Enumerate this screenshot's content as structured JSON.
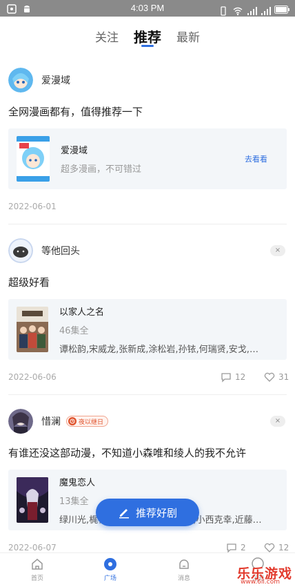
{
  "status_bar": {
    "time": "4:03 PM"
  },
  "tabs": [
    {
      "label": "关注",
      "active": false
    },
    {
      "label": "推荐",
      "active": true
    },
    {
      "label": "最新",
      "active": false
    }
  ],
  "posts": [
    {
      "username": "爱漫域",
      "text": "全网漫画都有，值得推荐一下",
      "card": {
        "title": "爱漫域",
        "subtitle": "超多漫画，不可错过",
        "action": "去看看"
      },
      "date": "2022-06-01"
    },
    {
      "username": "等他回头",
      "close": "×",
      "text": "超级好看",
      "card": {
        "title": "以家人之名",
        "episodes": "46集全",
        "cast": "谭松韵,宋威龙,张新成,涂松岩,孙铱,何瑞贤,安戈,苑..."
      },
      "date": "2022-06-06",
      "comments": "12",
      "likes": "31"
    },
    {
      "username": "惜澜",
      "badge": "夜以继日",
      "close": "×",
      "text": "有谁还没这部动漫，不知道小森唯和绫人的我不允许",
      "card": {
        "title": "魔鬼恋人",
        "episodes": "13集全",
        "cast": "绿川光,梶裕贵,平川大辅,鸟海浩辅,小西克幸,近藤隆..."
      },
      "date": "2022-06-07",
      "comments": "2",
      "likes": "12"
    }
  ],
  "fab": {
    "label": "推荐好剧"
  },
  "bottom_nav": [
    {
      "label": "首页",
      "icon": "home-icon"
    },
    {
      "label": "广场",
      "icon": "square-icon",
      "active": true
    },
    {
      "label": "消息",
      "icon": "message-icon"
    },
    {
      "label": "我的",
      "icon": "profile-icon"
    }
  ],
  "watermark": {
    "text": "乐乐游戏",
    "sub": "www.6ll.com"
  },
  "colors": {
    "accent": "#2f6fe0",
    "badge": "#e0542e",
    "statusbar": "#8a8a8a"
  }
}
